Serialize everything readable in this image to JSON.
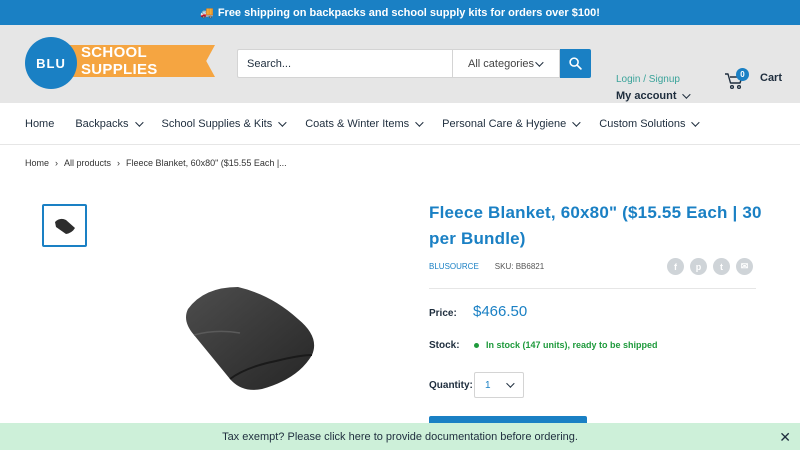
{
  "announcement": {
    "text": "Free shipping on backpacks and school supply kits for orders over $100!"
  },
  "header": {
    "logo": {
      "circle_text": "BLU",
      "banner_text": "SCHOOL SUPPLIES"
    },
    "search": {
      "placeholder": "Search...",
      "category": "All categories"
    },
    "account": {
      "login": "Login / Signup",
      "my_account": "My account"
    },
    "cart": {
      "count": "0",
      "label": "Cart"
    }
  },
  "nav": {
    "items": [
      {
        "label": "Home",
        "dropdown": false
      },
      {
        "label": "Backpacks",
        "dropdown": true
      },
      {
        "label": "School Supplies & Kits",
        "dropdown": true
      },
      {
        "label": "Coats & Winter Items",
        "dropdown": true
      },
      {
        "label": "Personal Care & Hygiene",
        "dropdown": true
      },
      {
        "label": "Custom Solutions",
        "dropdown": true
      }
    ]
  },
  "breadcrumb": {
    "home": "Home",
    "all_products": "All products",
    "current": "Fleece Blanket, 60x80\" ($15.55 Each |..."
  },
  "product": {
    "title": "Fleece Blanket, 60x80\" ($15.55 Each | 30 per Bundle)",
    "vendor": "BLUSOURCE",
    "sku": "SKU: BB6821",
    "price_label": "Price:",
    "price": "$466.50",
    "stock_label": "Stock:",
    "stock_text": "In stock (147 units), ready to be shipped",
    "quantity_label": "Quantity:",
    "quantity": "1"
  },
  "share": [
    "f",
    "p",
    "t",
    "✉"
  ],
  "notice": {
    "text": "Tax exempt? Please click here to provide documentation before ordering."
  }
}
